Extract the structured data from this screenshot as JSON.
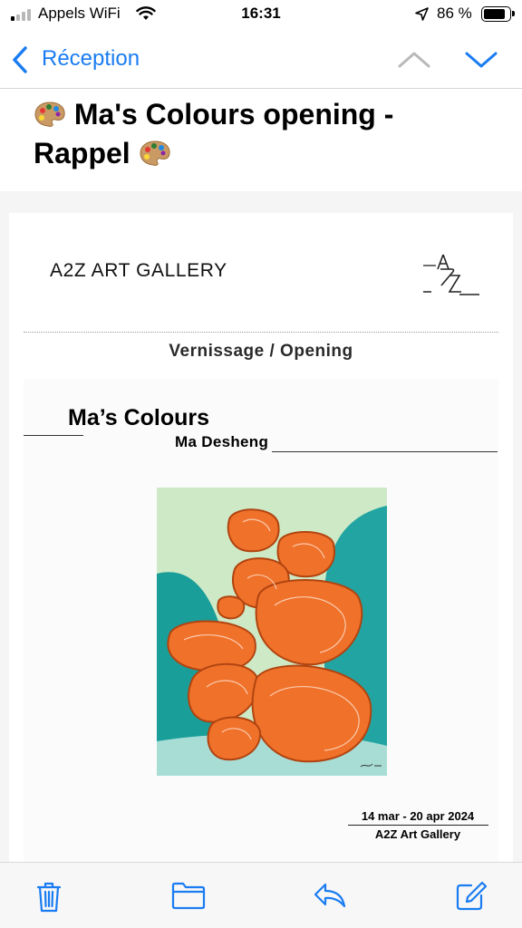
{
  "status_bar": {
    "carrier": "Appels WiFi",
    "time": "16:31",
    "battery": "86 %",
    "signal_bars_active": 1
  },
  "nav": {
    "back_label": "Réception",
    "accent": "#1a7cf2"
  },
  "email": {
    "subject": "Ma's Colours opening - Rappel",
    "subject_prefix_icon": "artist-palette-emoji",
    "subject_suffix_icon": "artist-palette-emoji"
  },
  "content": {
    "gallery_name": "A2Z ART GALLERY",
    "logo_text": "A2Z",
    "section_label": "Vernissage / Opening",
    "show_title": "Ma’s Colours",
    "artist": "Ma Desheng",
    "dates": "14 mar - 20 apr 2024",
    "venue": "A2Z Art Gallery",
    "artwork_colors": {
      "sky": "#cde9c6",
      "hills": "#1a9e9a",
      "stones": "#f0712a"
    }
  },
  "toolbar": {
    "icons": [
      "trash-icon",
      "folder-icon",
      "reply-icon",
      "compose-icon"
    ]
  }
}
